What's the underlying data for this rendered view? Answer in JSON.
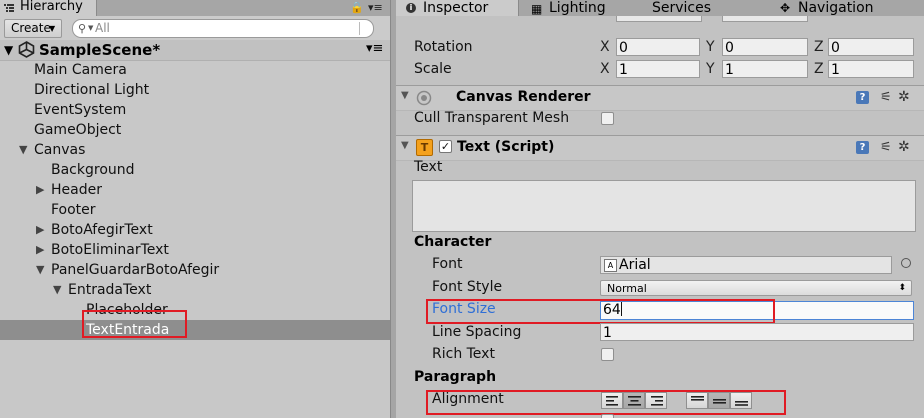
{
  "hierarchy": {
    "tab_label": "Hierarchy",
    "create_label": "Create",
    "search_placeholder": "All",
    "scene_name": "SampleScene*",
    "items": [
      {
        "label": "Main Camera",
        "arrow": ""
      },
      {
        "label": "Directional Light",
        "arrow": ""
      },
      {
        "label": "EventSystem",
        "arrow": ""
      },
      {
        "label": "GameObject",
        "arrow": ""
      },
      {
        "label": "Canvas",
        "arrow": "▼"
      },
      {
        "label": "Background",
        "arrow": ""
      },
      {
        "label": "Header",
        "arrow": "▶"
      },
      {
        "label": "Footer",
        "arrow": ""
      },
      {
        "label": "BotoAfegirText",
        "arrow": "▶"
      },
      {
        "label": "BotoEliminarText",
        "arrow": "▶"
      },
      {
        "label": "PanelGuardarBotoAfegir",
        "arrow": "▼"
      },
      {
        "label": "EntradaText",
        "arrow": "▼"
      },
      {
        "label": "Placeholder",
        "arrow": ""
      },
      {
        "label": "TextEntrada",
        "arrow": ""
      }
    ],
    "selected_item": "TextEntrada"
  },
  "inspector": {
    "tabs": {
      "inspector": "Inspector",
      "lighting": "Lighting",
      "services": "Services",
      "navigation": "Navigation"
    },
    "transform": {
      "rotation_label": "Rotation",
      "scale_label": "Scale",
      "x_label": "X",
      "y_label": "Y",
      "z_label": "Z",
      "rotation": {
        "x": "0",
        "y": "0",
        "z": "0"
      },
      "scale": {
        "x": "1",
        "y": "1",
        "z": "1"
      }
    },
    "canvas_renderer": {
      "title": "Canvas Renderer",
      "cull_label": "Cull Transparent Mesh",
      "cull_checked": false
    },
    "text_script": {
      "title": "Text (Script)",
      "enabled": true,
      "text_label": "Text",
      "text_value": "",
      "character_heading": "Character",
      "font_label": "Font",
      "font_value": "Arial",
      "font_style_label": "Font Style",
      "font_style_value": "Normal",
      "font_size_label": "Font Size",
      "font_size_value": "64",
      "line_spacing_label": "Line Spacing",
      "line_spacing_value": "1",
      "rich_text_label": "Rich Text",
      "rich_text_checked": false,
      "paragraph_heading": "Paragraph",
      "alignment_label": "Alignment",
      "horizontal_alignment": "center",
      "vertical_alignment": "middle"
    }
  },
  "colors": {
    "highlight": "#e01b24",
    "focus_blue": "#2f6fd6",
    "selection": "#8e8e8e"
  }
}
